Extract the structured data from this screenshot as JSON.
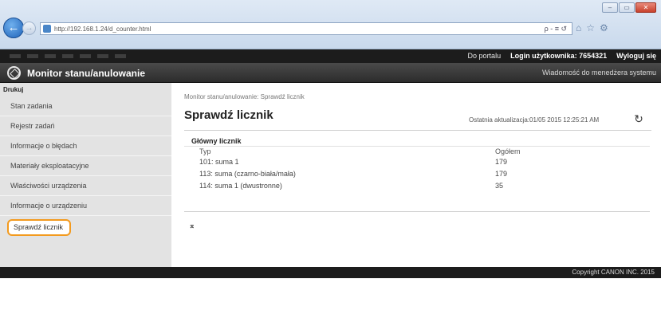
{
  "browser": {
    "url": "http://192.168.1.24/d_counter.html",
    "address_tools": "ρ - ≡ ↺",
    "window_buttons": {
      "minimize": "–",
      "maximize": "▭",
      "close": "✕"
    }
  },
  "topbar": {
    "portal_link": "Do portalu",
    "login_label": "Login użytkownika:",
    "login_value": "7654321",
    "logout_link": "Wyloguj się"
  },
  "header": {
    "title": "Monitor stanu/anulowanie",
    "admin_message_link": "Wiadomość do menedżera systemu"
  },
  "sidebar": {
    "section_heading": "Drukuj",
    "items": [
      {
        "label": "Stan zadania"
      },
      {
        "label": "Rejestr zadań"
      },
      {
        "label": "Informacje o błędach"
      },
      {
        "label": "Materiały eksploatacyjne"
      },
      {
        "label": "Właściwości urządzenia"
      },
      {
        "label": "Informacje o urządzeniu"
      },
      {
        "label": "Sprawdź licznik"
      }
    ]
  },
  "main": {
    "breadcrumb": "Monitor stanu/anulowanie: Sprawdź licznik",
    "title": "Sprawdź licznik",
    "last_update": "Ostatnia aktualizacja:01/05 2015 12:25:21 AM",
    "counter_box": {
      "heading": "Główny licznik",
      "columns": [
        "Typ",
        "Ogółem"
      ],
      "rows": [
        [
          "101: suma 1",
          "179"
        ],
        [
          "113: suma (czarno-biała/mała)",
          "179"
        ],
        [
          "114: suma 1 (dwustronne)",
          "35"
        ]
      ]
    },
    "top_icon_glyph": "⌅"
  },
  "footer": {
    "copyright": "Copyright CANON INC. 2015"
  }
}
